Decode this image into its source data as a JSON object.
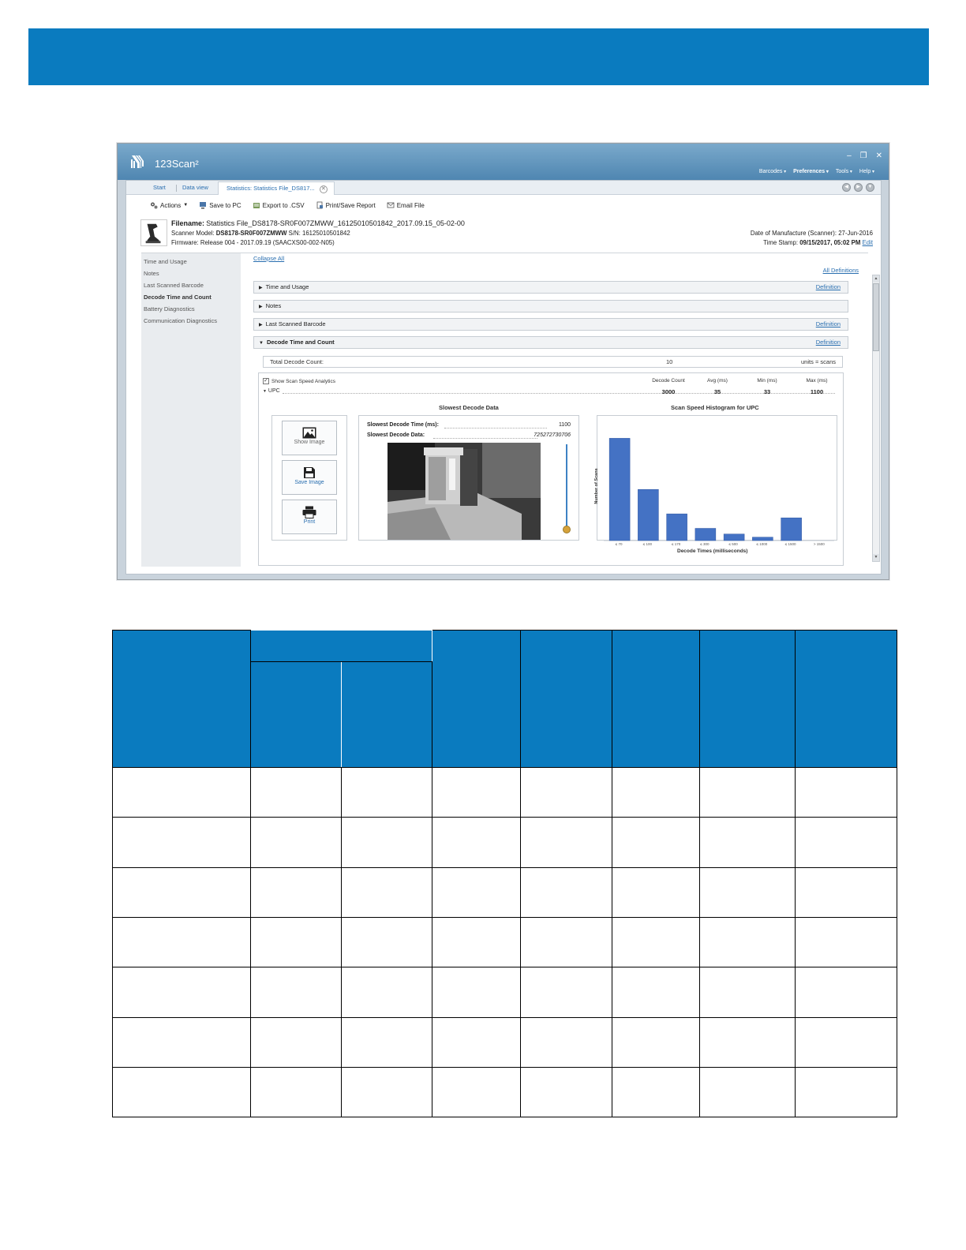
{
  "colors": {
    "banner": "#0a7bbf",
    "titlebar": "#5a8fb8",
    "link": "#2a6fb0",
    "bars": "#4472c4"
  },
  "app": {
    "title": "123Scan²",
    "menu": [
      "Barcodes",
      "Preferences",
      "Tools",
      "Help"
    ],
    "window_controls": [
      "–",
      "❐",
      "✕"
    ]
  },
  "tabs": {
    "start": "Start",
    "data_view": "Data view",
    "active": "Statistics: Statistics File_DS817..."
  },
  "toolbar": {
    "actions": "Actions",
    "save_pc": "Save to PC",
    "export_csv": "Export to .CSV",
    "print_report": "Print/Save Report",
    "email": "Email File"
  },
  "file": {
    "filename_label": "Filename:",
    "filename": "Statistics File_DS8178-SR0F007ZMWW_16125010501842_2017.09.15_05-02-00",
    "model_label": "Scanner Model:",
    "model": "DS8178-SR0F007ZMWW",
    "sn_label": "S/N:",
    "sn": "16125010501842",
    "firmware_label": "Firmware:",
    "firmware": "Release 004 - 2017.09.19 (SAACXS00-002-N05)",
    "dom_label": "Date of Manufacture (Scanner):",
    "dom": "27-Jun-2016",
    "ts_label": "Time Stamp:",
    "ts": "09/15/2017, 05:02 PM",
    "edit": "Edit"
  },
  "sidebar": {
    "items": [
      "Time and Usage",
      "Notes",
      "Last Scanned Barcode",
      "Decode Time and Count",
      "Battery Diagnostics",
      "Communication Diagnostics"
    ]
  },
  "main": {
    "collapse_all": "Collapse All",
    "all_definitions": "All Definitions",
    "definition": "Definition",
    "sections": [
      "Time and Usage",
      "Notes",
      "Last Scanned Barcode",
      "Decode Time and Count"
    ],
    "total_label": "Total Decode Count:",
    "total_value": "10",
    "units": "units = scans",
    "show_analytics": "Show Scan Speed Analytics",
    "upc": "UPC",
    "headers": {
      "decode_count": "Decode Count",
      "avg": "Avg (ms)",
      "min": "Min (ms)",
      "max": "Max (ms)"
    },
    "values": {
      "decode_count": "3000",
      "avg": "35",
      "min": "33",
      "max": "1100"
    },
    "slowest_title": "Slowest Decode Data",
    "slowest_time_label": "Slowest Decode Time (ms):",
    "slowest_time": "1100",
    "slowest_data_label": "Slowest Decode Data:",
    "slowest_data": "725272730706",
    "buttons": {
      "show_image": "Show Image",
      "save_image": "Save Image",
      "print": "Print"
    }
  },
  "chart_data": {
    "type": "bar",
    "title": "Scan Speed Histogram for UPC",
    "xlabel": "Decode Times (milliseconds)",
    "ylabel": "Number of Scans",
    "categories": [
      "≤ 70",
      "≤ 100",
      "≤ 170",
      "≤ 300",
      "≤ 500",
      "≤ 1000",
      "≤ 1500",
      "> 1500"
    ],
    "values": [
      1800,
      900,
      470,
      215,
      115,
      60,
      400,
      0
    ],
    "ylim": [
      0,
      2000
    ],
    "grid": false
  }
}
